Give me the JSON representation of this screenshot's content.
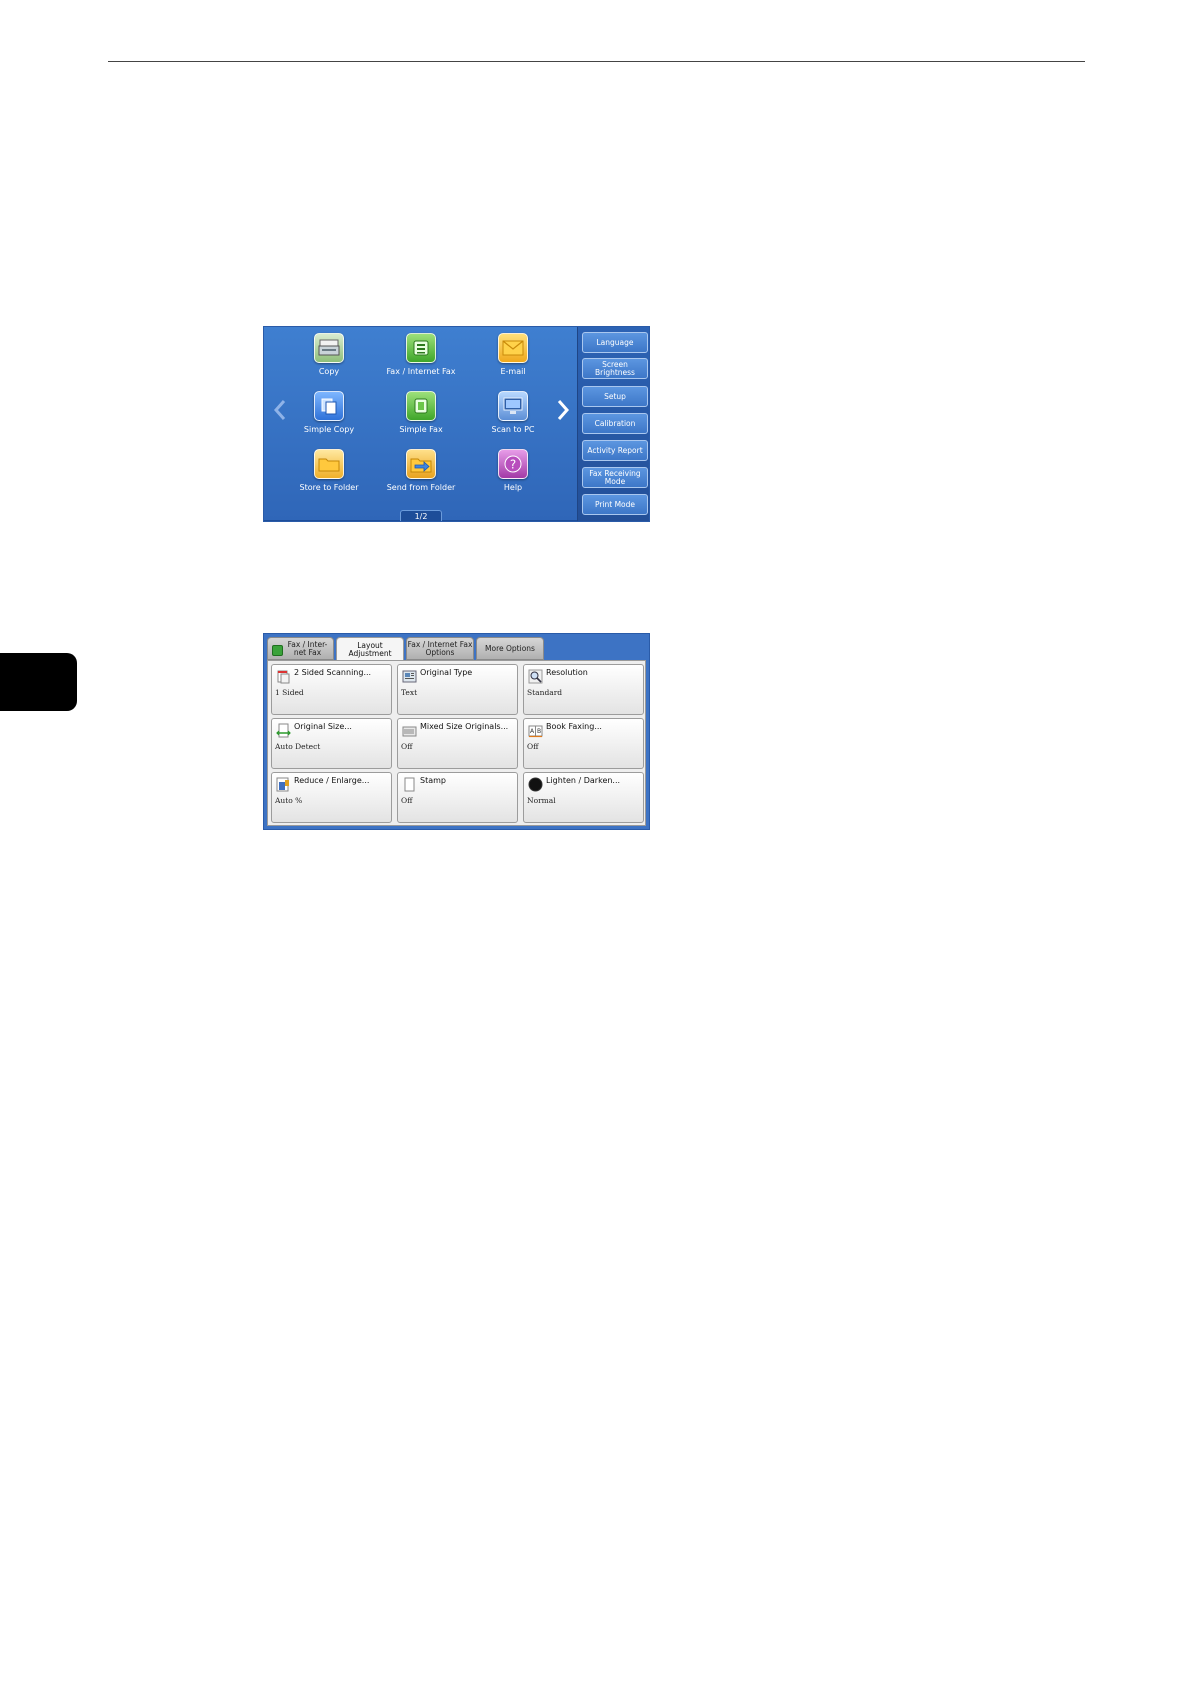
{
  "home": {
    "apps": [
      {
        "label": "Copy",
        "icon": "copy-icon"
      },
      {
        "label": "Fax / Internet Fax",
        "icon": "fax-icon"
      },
      {
        "label": "E-mail",
        "icon": "email-icon"
      },
      {
        "label": "Simple Copy",
        "icon": "simple-copy-icon"
      },
      {
        "label": "Simple Fax",
        "icon": "simple-fax-icon"
      },
      {
        "label": "Scan to PC",
        "icon": "scan-to-pc-icon"
      },
      {
        "label": "Store to Folder",
        "icon": "folder-icon"
      },
      {
        "label": "Send from Folder",
        "icon": "send-from-folder-icon"
      },
      {
        "label": "Help",
        "icon": "help-icon"
      }
    ],
    "page_indicator": "1/2",
    "side_buttons": [
      "Language",
      "Screen Brightness",
      "Setup",
      "Calibration",
      "Activity Report",
      "Fax Receiving Mode",
      "Print Mode"
    ]
  },
  "layout": {
    "tabs": [
      {
        "label": "Fax / Inter-net Fax"
      },
      {
        "label": "Layout Adjustment"
      },
      {
        "label": "Fax / Internet Fax Options"
      },
      {
        "label": "More Options"
      }
    ],
    "features": [
      {
        "title": "2 Sided Scanning...",
        "value": "1 Sided"
      },
      {
        "title": "Original Type",
        "value": "Text"
      },
      {
        "title": "Resolution",
        "value": "Standard"
      },
      {
        "title": "Original Size...",
        "value": "Auto Detect"
      },
      {
        "title": "Mixed Size Originals...",
        "value": "Off"
      },
      {
        "title": "Book Faxing...",
        "value": "Off"
      },
      {
        "title": "Reduce / Enlarge...",
        "value": "Auto %"
      },
      {
        "title": "Stamp",
        "value": "Off"
      },
      {
        "title": "Lighten / Darken...",
        "value": "Normal"
      }
    ]
  }
}
